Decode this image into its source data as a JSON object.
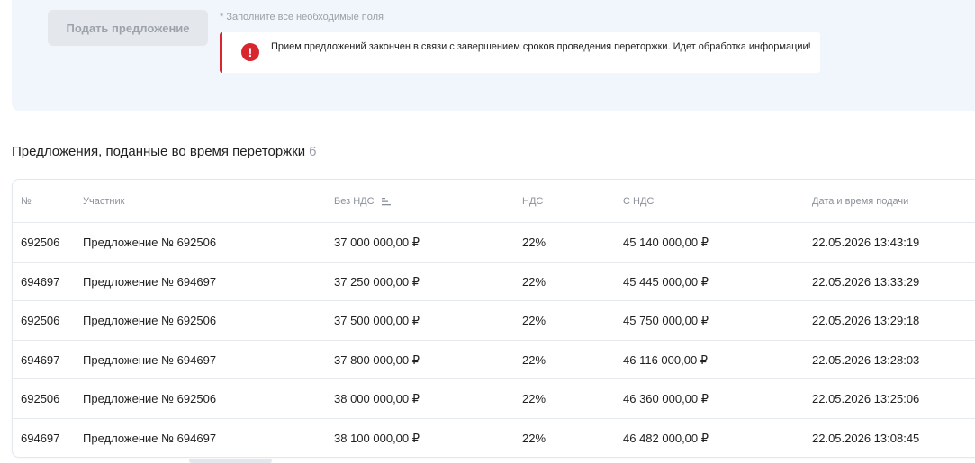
{
  "form": {
    "submit_label": "Подать предложение",
    "required_hint": "* Заполните все необходимые поля",
    "alert_icon": "exclamation-icon",
    "alert_text": "Прием предложений закончен в связи с завершением сроков проведения переторжки. Идет обработка информации!",
    "alert_color": "#d9262e"
  },
  "section": {
    "title": "Предложения, поданные во время переторжки",
    "count": "6"
  },
  "table": {
    "headers": [
      "№",
      "Участник",
      "Без НДС",
      "НДС",
      "С НДС",
      "Дата и время подачи"
    ],
    "sort_icon": "sort-ascending-icon",
    "rows": [
      [
        "692506",
        "Предложение № 692506",
        "37 000 000,00 ₽",
        "22%",
        "45 140 000,00 ₽",
        "22.05.2026 13:43:19"
      ],
      [
        "694697",
        "Предложение № 694697",
        "37 250 000,00 ₽",
        "22%",
        "45 445 000,00 ₽",
        "22.05.2026 13:33:29"
      ],
      [
        "692506",
        "Предложение № 692506",
        "37 500 000,00 ₽",
        "22%",
        "45 750 000,00 ₽",
        "22.05.2026 13:29:18"
      ],
      [
        "694697",
        "Предложение № 694697",
        "37 800 000,00 ₽",
        "22%",
        "46 116 000,00 ₽",
        "22.05.2026 13:28:03"
      ],
      [
        "692506",
        "Предложение № 692506",
        "38 000 000,00 ₽",
        "22%",
        "46 360 000,00 ₽",
        "22.05.2026 13:25:06"
      ],
      [
        "694697",
        "Предложение № 694697",
        "38 100 000,00 ₽",
        "22%",
        "46 482 000,00 ₽",
        "22.05.2026 13:08:45"
      ]
    ]
  }
}
